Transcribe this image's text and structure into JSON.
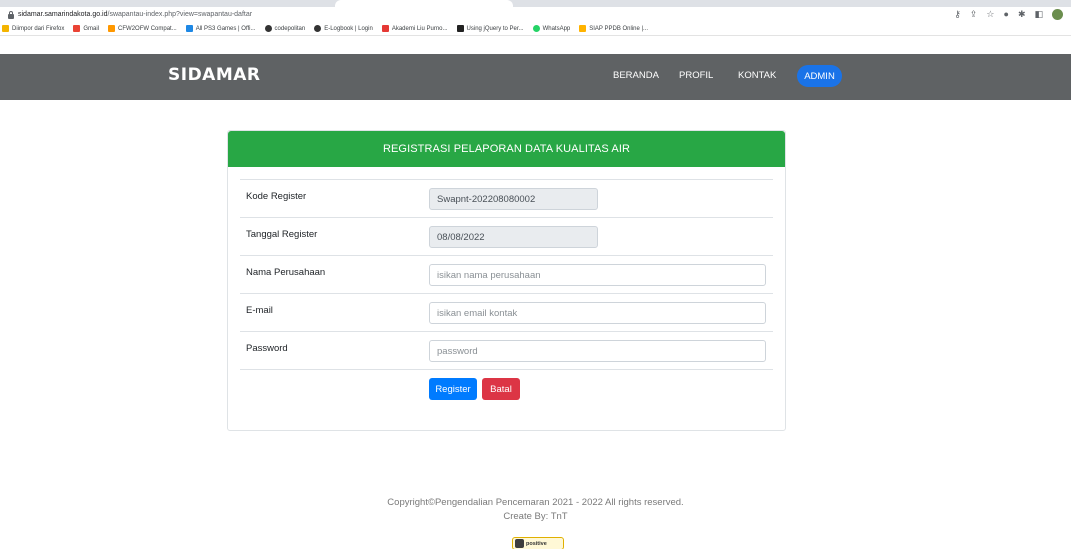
{
  "browser": {
    "url_host": "sidamar.samarindakota.go.id",
    "url_path": "/swapantau-index.php?view=swapantau-daftar",
    "bookmarks": [
      {
        "label": "Diimpor dari Firefox",
        "color": "#f4b400"
      },
      {
        "label": "Gmail",
        "color": "#ea4335"
      },
      {
        "label": "CFW2OFW Compat...",
        "color": "#ff9800"
      },
      {
        "label": "All PS3 Games | Offi...",
        "color": "#1e88e5"
      },
      {
        "label": "codepolitan",
        "color": "#333333"
      },
      {
        "label": "E-Logbook | Login",
        "color": "#333333"
      },
      {
        "label": "Akademi Liu Purno...",
        "color": "#e53935"
      },
      {
        "label": "Using jQuery to Per...",
        "color": "#222222"
      },
      {
        "label": "WhatsApp",
        "color": "#25d366"
      },
      {
        "label": "SIAP PPDB Online |...",
        "color": "#ffb300"
      }
    ]
  },
  "navbar": {
    "brand": "SIDAMAR",
    "links": [
      "BERANDA",
      "PROFIL",
      "KONTAK"
    ],
    "admin_label": "ADMIN",
    "bg_color": "#5f6264",
    "admin_color": "#1a73e8"
  },
  "form": {
    "title": "REGISTRASI PELAPORAN DATA KUALITAS AIR",
    "header_color": "#28a745",
    "fields": [
      {
        "label": "Kode Register",
        "value": "Swapnt-202208080002",
        "placeholder": ""
      },
      {
        "label": "Tanggal Register",
        "value": "08/08/2022",
        "placeholder": ""
      },
      {
        "label": "Nama Perusahaan",
        "value": "",
        "placeholder": "isikan nama perusahaan"
      },
      {
        "label": "E-mail",
        "value": "",
        "placeholder": "isikan email kontak"
      },
      {
        "label": "Password",
        "value": "",
        "placeholder": "password"
      }
    ],
    "register_label": "Register",
    "cancel_label": "Batal"
  },
  "footer": {
    "copyright": "Copyright©Pengendalian Pencemaran 2021 - 2022 All rights reserved.",
    "credit": "Create By: TnT",
    "badge_text": "positive"
  }
}
